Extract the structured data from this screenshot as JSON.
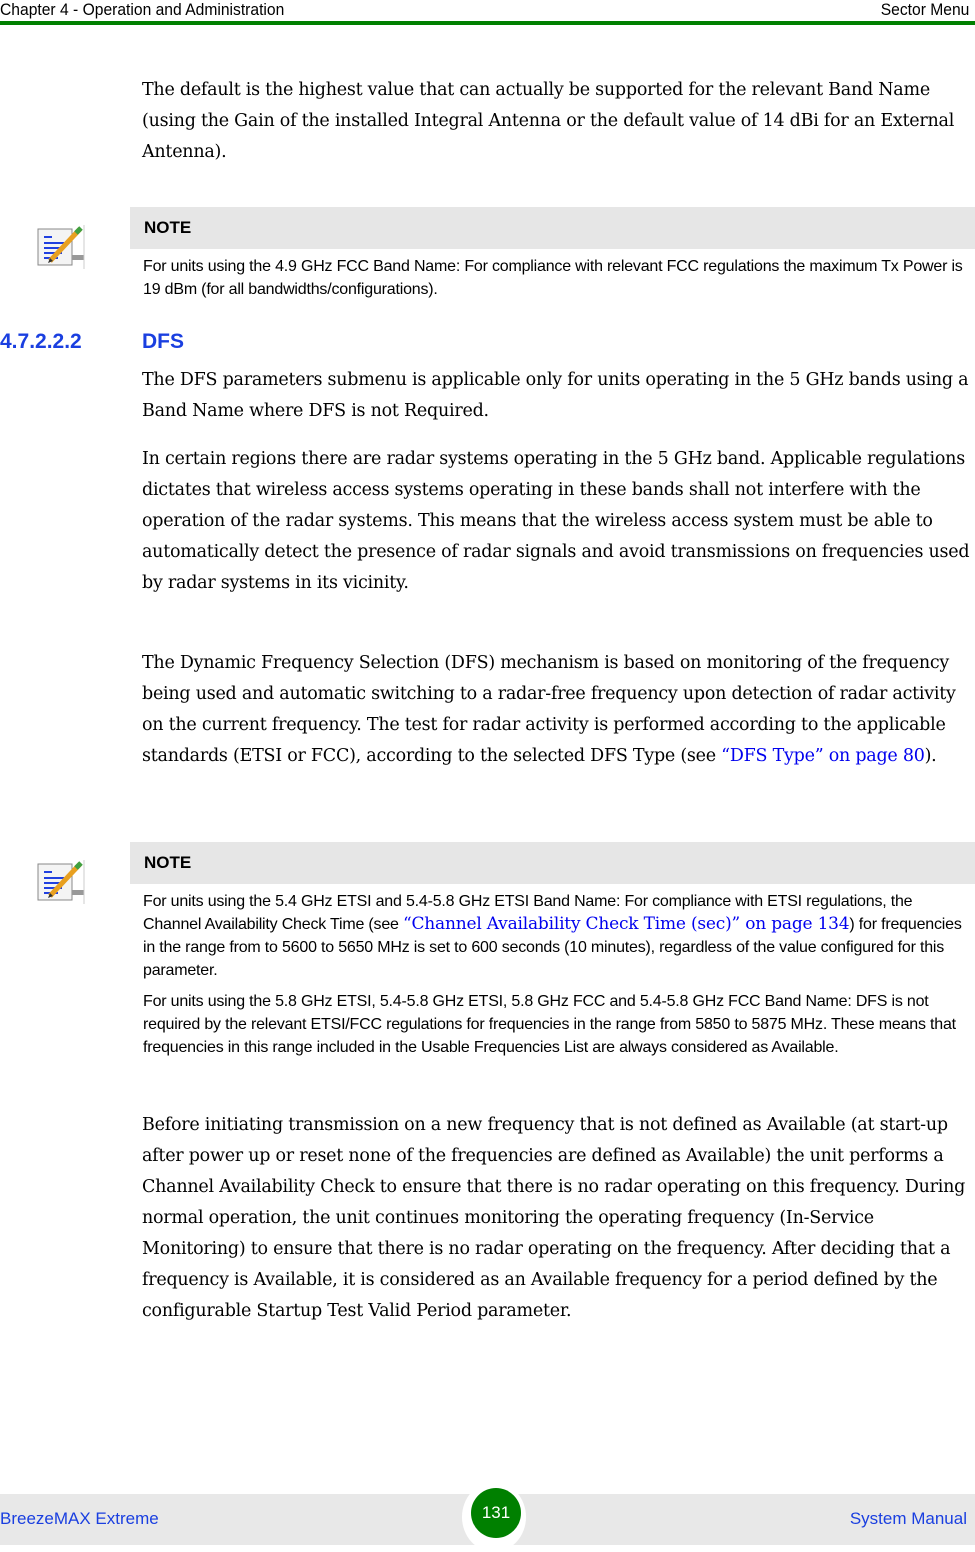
{
  "header": {
    "chapter": "Chapter 4 - Operation and Administration",
    "section": "Sector Menu",
    "rule_color": "#008000"
  },
  "intro_paragraph": "The default is the highest value that can actually be supported for the relevant Band Name (using the Gain of the installed Integral Antenna or the default value of 14 dBi for an External Antenna).",
  "note1": {
    "icon": "note-pencil-icon",
    "title": "NOTE",
    "body": "For units using the 4.9 GHz FCC Band Name: For compliance with relevant FCC regulations the maximum Tx Power is 19 dBm (for all bandwidths/configurations)."
  },
  "section": {
    "number": "4.7.2.2.2",
    "title": "DFS",
    "color": "#1a3fe0"
  },
  "paragraphs": {
    "p1": "The DFS parameters submenu is applicable only for units operating in the 5 GHz bands using a Band Name where DFS is not Required.",
    "p2": "In certain regions there are radar systems operating in the 5 GHz band. Applicable regulations dictates that wireless access systems operating in these bands shall not interfere with the operation of the radar systems. This means that the wireless access system must be able to automatically detect the presence of radar signals and avoid transmissions on frequencies used by radar systems in its vicinity.",
    "p3_before": "The Dynamic Frequency Selection (DFS) mechanism is based on monitoring of the frequency being used and automatic switching to a radar-free frequency upon detection of radar activity on the current frequency. The test for radar activity is performed according to the applicable standards (ETSI or FCC), according to the selected DFS Type (see ",
    "p3_link": "“DFS Type” on page 80",
    "p3_after": ").",
    "p4": "Before initiating transmission on a new frequency that is not defined as Available (at start-up after power up or reset none of the frequencies are defined as Available) the unit performs a Channel Availability Check to ensure that there is no radar operating on this frequency. During normal operation, the unit continues monitoring the operating frequency (In-Service Monitoring) to ensure that there is no radar operating on the frequency. After deciding that a frequency is Available, it is considered as an Available frequency for a period defined by the configurable Startup Test Valid Period parameter."
  },
  "note2": {
    "icon": "note-pencil-icon",
    "title": "NOTE",
    "body1_before": "For units using the 5.4 GHz ETSI and 5.4-5.8 GHz ETSI Band Name: For compliance with ETSI regulations, the Channel Availability Check Time (see ",
    "body1_link": "“Channel Availability Check Time (sec)” on page 134",
    "body1_after": ") for frequencies in the range from to 5600 to 5650 MHz is set to 600 seconds (10 minutes), regardless of the value configured for this parameter.",
    "body2": "For units using the 5.8 GHz ETSI, 5.4-5.8 GHz ETSI, 5.8 GHz FCC and 5.4-5.8 GHz FCC Band Name: DFS is not required by the relevant ETSI/FCC regulations for frequencies in the range from 5850 to 5875 MHz. These means that frequencies in this range included in the Usable Frequencies List are always considered as Available."
  },
  "footer": {
    "product": "BreezeMAX Extreme",
    "page_number": "131",
    "manual": "System Manual"
  }
}
